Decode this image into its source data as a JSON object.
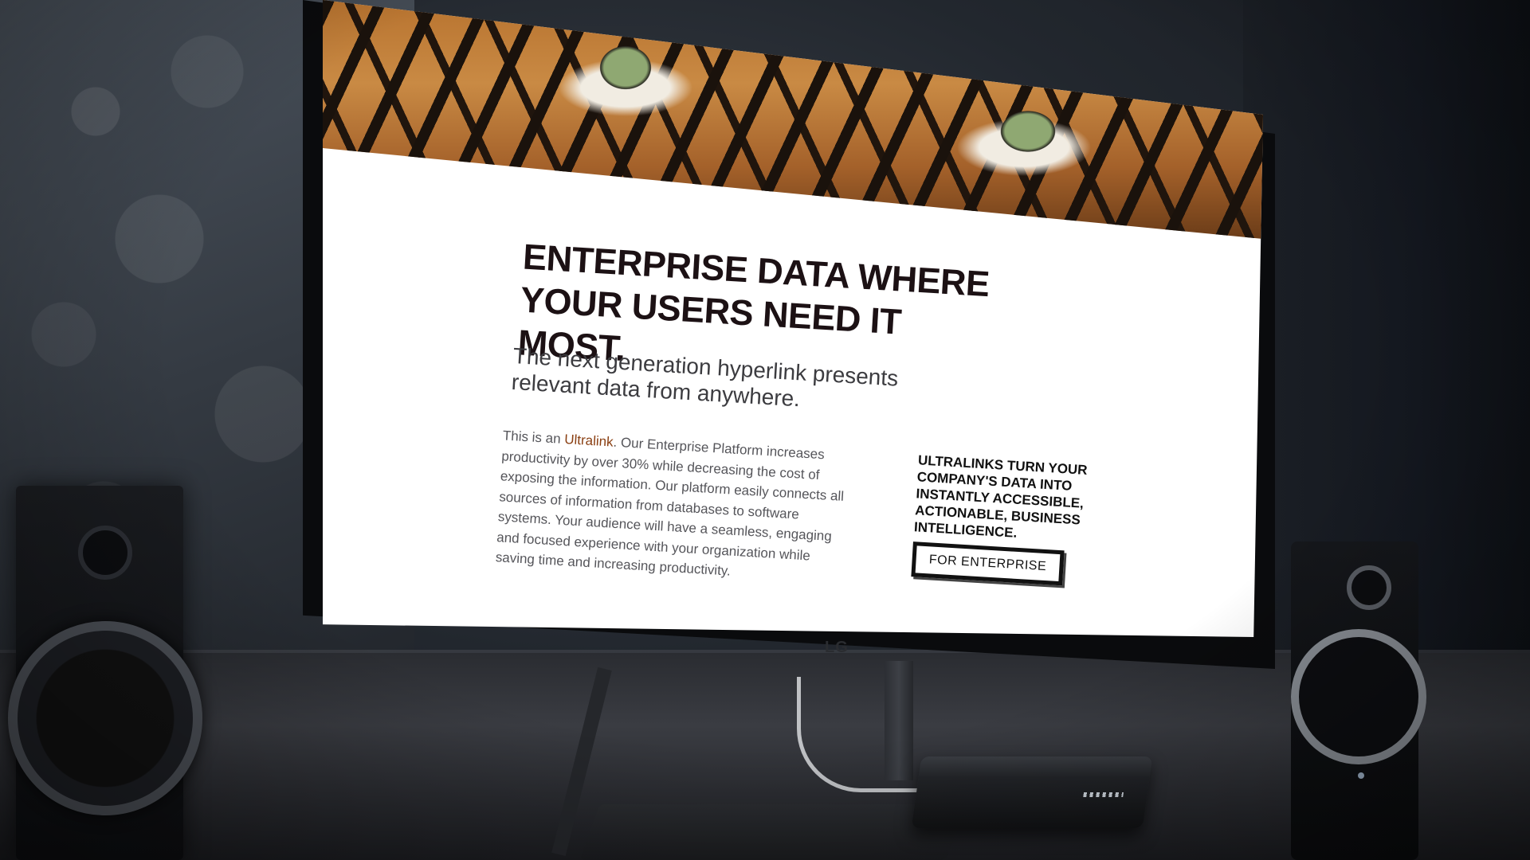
{
  "screen": {
    "headline": "ENTERPRISE DATA WHERE YOUR USERS NEED IT MOST.",
    "subheadline": "The next generation hyperlink presents relevant data from anywhere.",
    "body": {
      "prefix": "This is an ",
      "link_text": "Ultralink",
      "suffix": ". Our Enterprise Platform increases productivity by over 30% while decreasing the cost of exposing the information. Our platform easily connects all sources of information from databases to software systems. Your audience will have a seamless, engaging and focused experience with your organization while saving time and increasing productivity."
    },
    "cta_text": "ULTRALINKS TURN YOUR COMPANY'S DATA INTO INSTANTLY ACCESSIBLE, ACTIONABLE, BUSINESS INTELLIGENCE.",
    "cta_button": "FOR ENTERPRISE"
  },
  "monitor": {
    "brand": "LG"
  },
  "colors": {
    "link": "#8a3f12",
    "headline": "#1c1114",
    "body": "#55555a",
    "screen_bg": "#ffffff"
  },
  "icons": [
    "speaker-icon"
  ]
}
